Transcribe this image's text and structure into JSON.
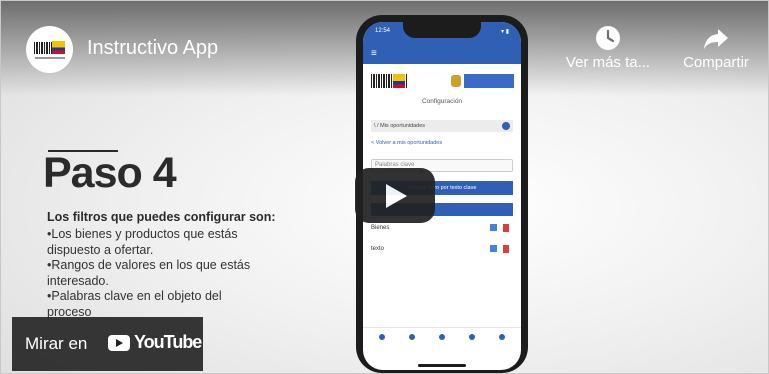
{
  "header": {
    "channel_logo_name": "channel-logo",
    "title": "Instructivo App",
    "actions": [
      {
        "label": "Ver más ta...",
        "icon": "clock-icon"
      },
      {
        "label": "Compartir",
        "icon": "share-icon"
      }
    ]
  },
  "slide": {
    "heading": "Paso 4",
    "filters_heading": "Los filtros que puedes configurar son:",
    "filters": [
      "•Los bienes y productos que estás",
      "dispuesto a ofertar.",
      "•Rangos de valores en los que estás",
      "interesado.",
      "•Palabras clave en el objeto del",
      "proceso"
    ]
  },
  "phone_app": {
    "status_time": "12:54",
    "status_icons": "▾ ▮",
    "menu_icon": "≡",
    "page_title": "Configuración",
    "breadcrumb": "\\ / Mis oportunidades",
    "back_link": "< Volver a mis oportunidades",
    "keyword_placeholder": "Palabras clave",
    "filter_button": "Agregar filtro por texto clave",
    "rows": [
      {
        "label": "Bienes"
      },
      {
        "label": "texto"
      }
    ]
  },
  "watch_on": {
    "label": "Mirar en",
    "brand": "YouTube"
  },
  "colors": {
    "app_blue": "#2f60b5",
    "delete_red": "#e23b3b",
    "overlay_dark": "#212121"
  }
}
